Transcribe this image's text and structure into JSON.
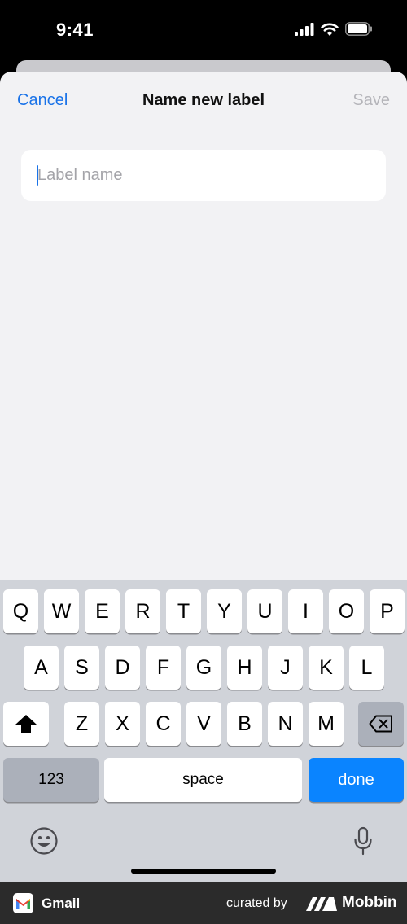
{
  "status_bar": {
    "time": "9:41"
  },
  "nav": {
    "cancel_label": "Cancel",
    "title": "Name new label",
    "save_label": "Save"
  },
  "label_input": {
    "placeholder": "Label name",
    "value": ""
  },
  "keyboard": {
    "row1": [
      "Q",
      "W",
      "E",
      "R",
      "T",
      "Y",
      "U",
      "I",
      "O",
      "P"
    ],
    "row2": [
      "A",
      "S",
      "D",
      "F",
      "G",
      "H",
      "J",
      "K",
      "L"
    ],
    "row3": [
      "Z",
      "X",
      "C",
      "V",
      "B",
      "N",
      "M"
    ],
    "numbers_label": "123",
    "space_label": "space",
    "done_label": "done"
  },
  "footer": {
    "app_name": "Gmail",
    "curated_by": "curated by",
    "brand": "Mobbin"
  },
  "colors": {
    "accent": "#1a73e8",
    "done_key": "#0a84ff",
    "sheet_bg": "#f2f2f4",
    "keyboard_bg": "#d0d3d9"
  }
}
